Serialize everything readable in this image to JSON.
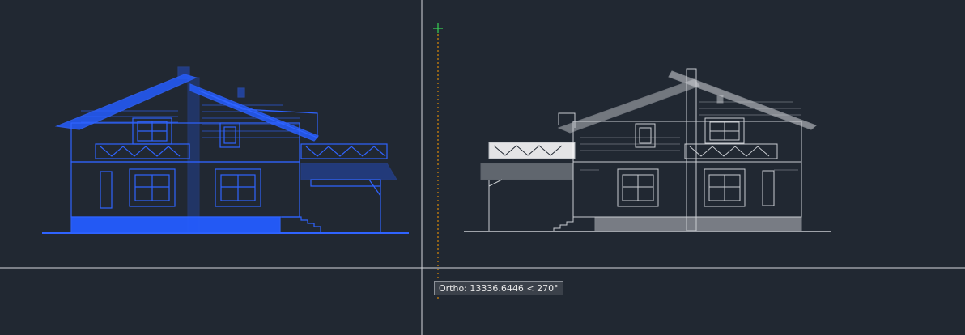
{
  "viewport": {
    "background": "#212832",
    "selected_color": "#2f63ff",
    "unselected_color": "#c9ccd1",
    "crosshair_color": "#d7d9de",
    "ortho_track_color": "#ff9b00",
    "cursor_marker_color": "#39d353"
  },
  "drawings": {
    "left_elevation_state": "selected",
    "right_elevation_state": "unselected"
  },
  "tooltip": {
    "text": "Ortho: 13336.6446 < 270°"
  }
}
